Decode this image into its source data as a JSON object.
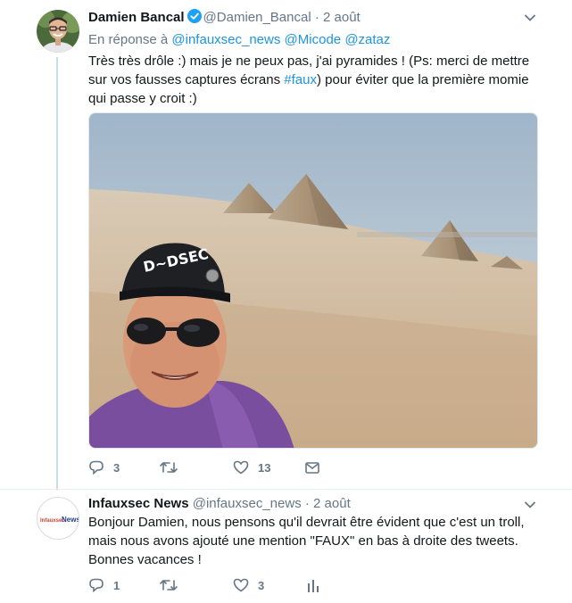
{
  "tweets": [
    {
      "name": "Damien Bancal",
      "handle": "@Damien_Bancal",
      "separator": "·",
      "date": "2 août",
      "verified": true,
      "reply_prefix": "En réponse à",
      "reply_to": [
        "@infauxsec_news",
        "@Micode",
        "@zataz"
      ],
      "text_before": "Très très drôle :) mais je ne peux pas, j'ai pyramides ! (Ps: merci de mettre sur vos fausses captures écrans ",
      "hashtag": "#faux",
      "text_after": ") pour éviter que la première momie qui passe y croit :)",
      "cap_text": "D~DSEC",
      "replies": "3",
      "retweets": "",
      "likes": "13"
    },
    {
      "name": "Infauxsec News",
      "handle": "@infauxsec_news",
      "separator": "·",
      "date": "2 août",
      "avatar_text_a": "Infauxsec",
      "avatar_text_b": "News",
      "text": "Bonjour Damien, nous pensons qu'il devrait être évident que c'est un troll, mais nous avons ajouté une mention \"FAUX\" en bas à droite des tweets. Bonnes vacances !",
      "replies": "1",
      "retweets": "",
      "likes": "3"
    }
  ],
  "colors": {
    "link": "#1b95e0",
    "secondary": "#657786",
    "thread_line": "#c4def2",
    "verified": "#1da1f2"
  },
  "icons": [
    "verified-badge-icon",
    "chevron-down-icon",
    "reply-icon",
    "retweet-icon",
    "like-icon",
    "direct-message-icon",
    "analytics-icon"
  ]
}
